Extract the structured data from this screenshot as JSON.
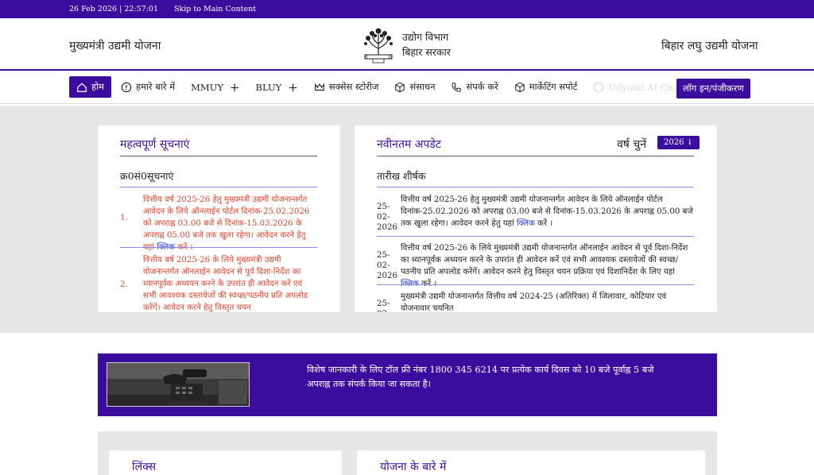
{
  "topbar": {
    "datetime": "26 Feb 2026 | 22:57:01",
    "skip_link": "Skip to Main Content"
  },
  "header": {
    "left_title": "मुख्यमंत्री उद्यमी योजना",
    "dept_line1": "उद्योग विभाग",
    "dept_line2": "बिहार सरकार",
    "right_title": "बिहार लघु उद्यमी योजना"
  },
  "nav": {
    "home": "होम",
    "about": "हमारे बारे में",
    "mmuy": "MMUY",
    "bluy": "BLUY",
    "success": "सक्सेस स्टोरीज",
    "resources": "संसाधन",
    "contact": "संपर्क करें",
    "marketing": "मार्केटिंग सपोर्ट",
    "chatbot": "Udyami AI Chat Bot",
    "login": "लॉग इन/पंजीकरण"
  },
  "notices": {
    "title": "महत्वपूर्ण सूचनाएं",
    "col_heads": "क्र0सं0सूचनाएं",
    "items": [
      {
        "num": "1.",
        "text": "वित्तीय वर्ष 2025-26 हेतु मुख्यमंत्री उद्यमी योजनान्तर्गत आवेदन के लिये ऑनलाईन पोर्टल दिनांक-25.02.2026 को अपराह्न 03.00 बजे से दिनांक-15.03.2026 के अपराह्न 05.00 बजे तक खुला रहेगा। आवेदन करने हेतु यहां",
        "link": "क्लिक",
        "tail": "करें ।"
      },
      {
        "num": "2.",
        "text": "वित्तीय वर्ष 2025-26 के लिये मुख्यमंत्री उद्यमी योजनान्तर्गत ऑनलाईन आवेदन से पूर्व दिशा-निर्देश का ध्यानपूर्वक अध्ययन करने के उपरांत ही आवेदन करें एवं सभी आवश्यक दस्तावेजों की स्वच्छ/पठनीय प्रति अपलोड करेंगें। आवेदन करने हेतु विस्तृत चयन",
        "link": "",
        "tail": ""
      }
    ]
  },
  "updates": {
    "title": "नवीनतम अपडेट",
    "year_label": "वर्ष चुनें",
    "year_value": "2026 ↓",
    "col_heads": "तारीख शीर्षक",
    "items": [
      {
        "date": "25-02-2026",
        "text": "वित्तीय वर्ष 2025-26 हेतु मुख्यमंत्री उद्यमी योजनान्तर्गत आवेदन के लिये ऑनलाईन पोर्टल दिनांक-25.02.2026 को अपराह्न 03.00 बजे से दिनांक-15.03.2026 के अपराह्न 05.00 बजे तक खुला रहेगा। आवेदन करने हेतु यहां",
        "link": "क्लिक",
        "tail": "करें ।"
      },
      {
        "date": "25-02-2026",
        "text": "वित्तीय वर्ष 2025-26 के लिये मुख्यमंत्री उद्यमी योजनान्तर्गत ऑनलाईन आवेदन से पूर्व दिशा-निर्देश का ध्यानपूर्वक अध्ययन करने के उपरांत ही आवेदन करें एवं सभी आवश्यक दस्तावेजों की स्वच्छ/पठनीय प्रति अपलोड करेंगें। आवेदन करने हेतु विस्तृत चयन प्रक्रिया एवं दिशानिर्देश के लिए यहां",
        "link": "क्लिक",
        "tail": "करें ।"
      },
      {
        "date": "25-02",
        "text": "मुख्यमंत्री उद्यमी योजनान्तर्गत वित्तीय वर्ष 2024-25 (अतिरिक्त) में जिलावार, कोटियार एवं योजनावार चयनित",
        "link": "",
        "tail": ""
      }
    ]
  },
  "banner": {
    "text": "विशेष जानकारी के लिए टॉल फ्री नंबर 1800 345 6214 पर प्रत्येक कार्य दिवस को 10 बजे पूर्वाह्न 5 बजे अपराह्न तक संपर्क किया जा सकता है।"
  },
  "bottom": {
    "links_title": "लिंक्स",
    "about_title": "योजना के बारे में"
  },
  "colors": {
    "primary": "#3a0d9e",
    "notice_text": "#e0452f",
    "link": "#1f3ad8"
  }
}
